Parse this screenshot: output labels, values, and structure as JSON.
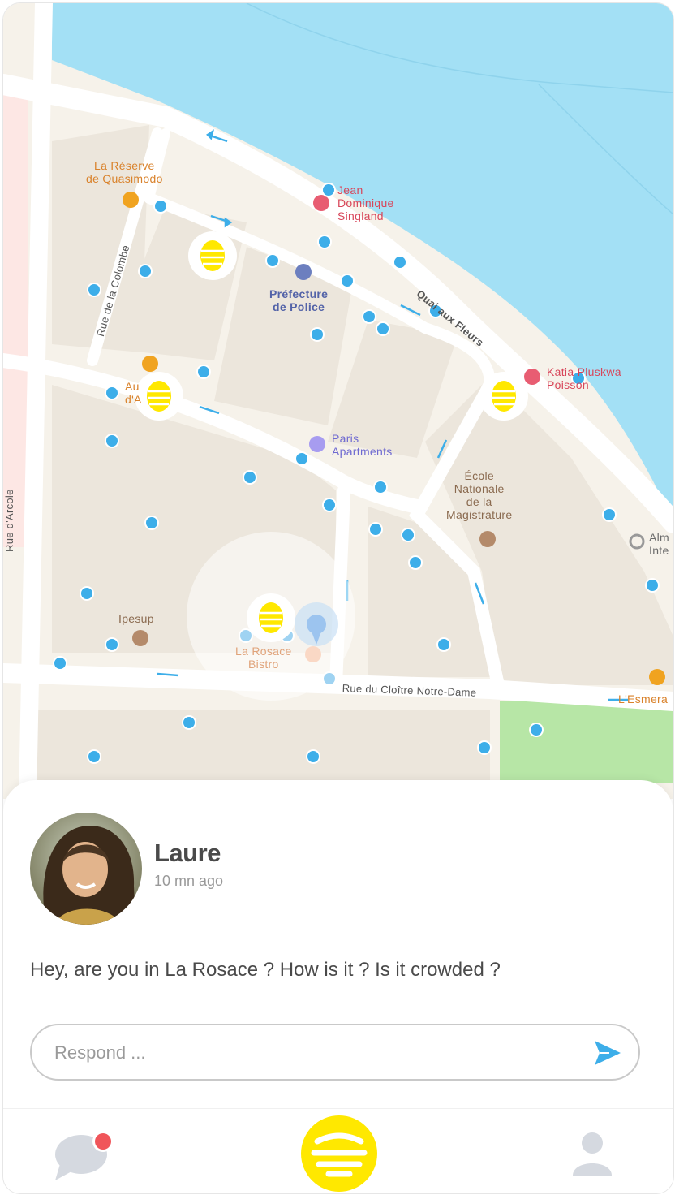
{
  "map": {
    "labels": {
      "reserve": "La Réserve\nde Quasimodo",
      "jean": "Jean\nDominique\nSingland",
      "prefecture": "Préfecture\nde Police",
      "quai": "Quai aux Fleurs",
      "colombe": "Rue de la Colombe",
      "katia": "Katia Pluskwa\nPoisson",
      "auberge": "Au\nd'A",
      "paris_apartments": "Paris\nApartments",
      "ecole": "École\nNationale\nde la\nMagistrature",
      "arcole": "Rue d'Arcole",
      "alm": "Alm\nInte",
      "ipesup": "Ipesup",
      "rosace": "La Rosace\nBistro",
      "cloitre": "Rue du Cloître Notre-Dame",
      "esmera": "L'Esmera"
    },
    "colors": {
      "water": "#a3e0f5",
      "land": "#f6f2ea",
      "block": "#ece6dc",
      "road": "#ffffff",
      "park": "#b7e6a6",
      "dot": "#3daee9",
      "hive": "#ffe800"
    }
  },
  "post": {
    "author": "Laure",
    "time": "10 mn ago",
    "message": "Hey, are you in La Rosace ? How is it ? Is it crowded ?",
    "input_placeholder": "Respond ..."
  },
  "nav": {
    "chat_icon": "chat-bubble-icon",
    "chat_badge_color": "#f0555a",
    "home_icon": "hive-logo-icon",
    "profile_icon": "user-icon"
  }
}
